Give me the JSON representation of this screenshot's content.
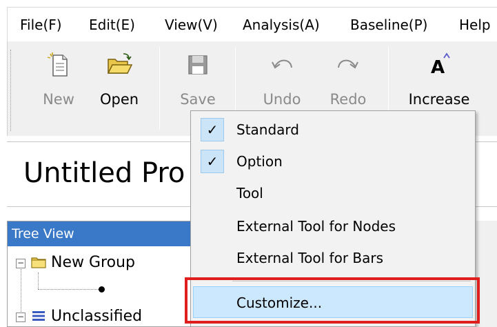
{
  "menubar": {
    "items": [
      "File(F)",
      "Edit(E)",
      "View(V)",
      "Analysis(A)",
      "Baseline(P)",
      "Help"
    ]
  },
  "toolbar": {
    "new": {
      "label": "New",
      "icon": "new-document-icon"
    },
    "open": {
      "label": "Open",
      "icon": "open-folder-icon"
    },
    "save": {
      "label": "Save",
      "icon": "save-icon"
    },
    "undo": {
      "label": "Undo",
      "icon": "undo-icon"
    },
    "redo": {
      "label": "Redo",
      "icon": "redo-icon"
    },
    "increase": {
      "label": "Increase",
      "icon": "font-increase-icon"
    }
  },
  "project": {
    "title": "Untitled Pro"
  },
  "tree": {
    "header": "Tree View",
    "group": "New Group",
    "unclassified": "Unclassified"
  },
  "context_menu": {
    "items": [
      {
        "label": "Standard",
        "checked": true
      },
      {
        "label": "Option",
        "checked": true
      },
      {
        "label": "Tool",
        "checked": false
      },
      {
        "label": "External Tool for Nodes",
        "checked": false
      },
      {
        "label": "External Tool for Bars",
        "checked": false
      },
      {
        "label": "Customize...",
        "checked": false,
        "highlighted": true
      }
    ],
    "check_glyph": "✓"
  },
  "colors": {
    "highlight_outline": "#e01e1e",
    "tree_header_bg": "#3a78c8",
    "menu_hover": "#cce8ff"
  }
}
